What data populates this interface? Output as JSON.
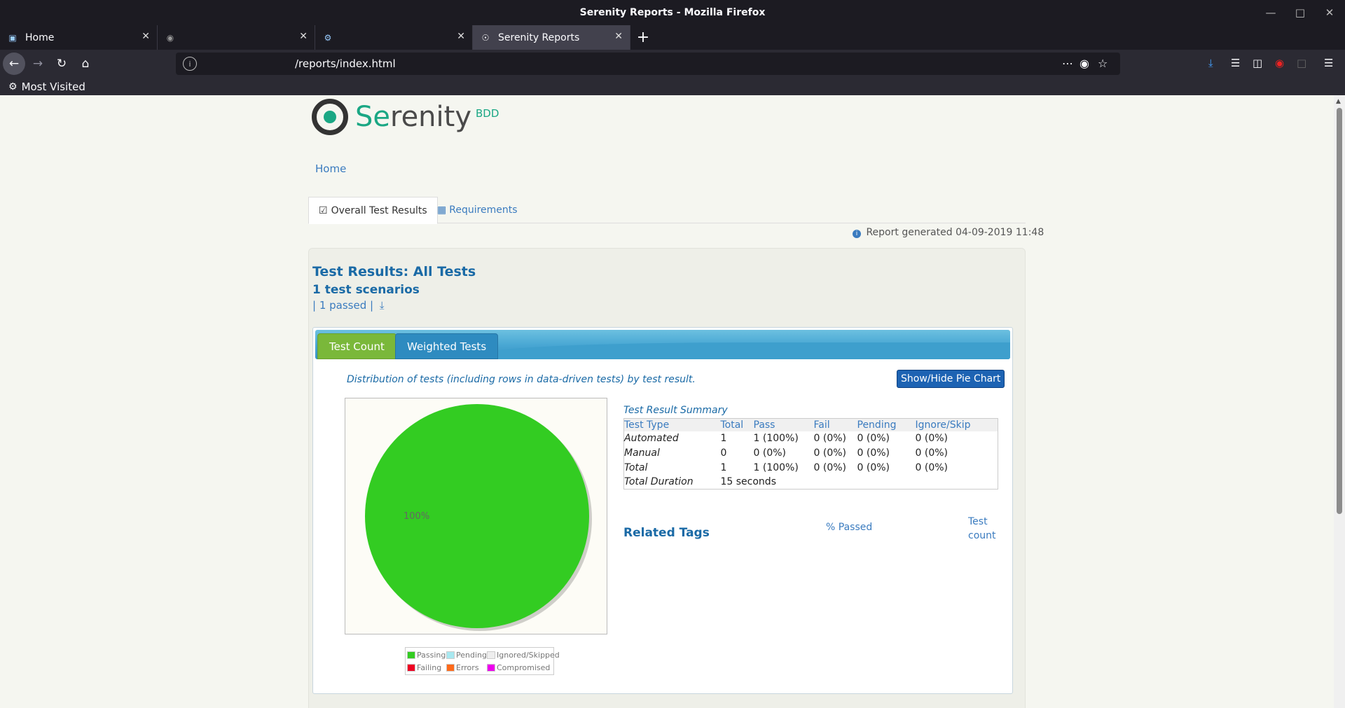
{
  "window": {
    "title": "Serenity Reports - Mozilla Firefox"
  },
  "tabs": [
    {
      "label": "Home",
      "icon": "page-icon"
    },
    {
      "label": "",
      "icon": "github-icon"
    },
    {
      "label": "",
      "icon": "puzzle-icon"
    },
    {
      "label": "Serenity Reports",
      "icon": "serenity-icon",
      "active": true
    }
  ],
  "urlbar": {
    "url": "/reports/index.html"
  },
  "bookmarks": {
    "most_visited": "Most Visited"
  },
  "logo": {
    "word_prefix": "Se",
    "word_rest": "renity",
    "bdd": "BDD"
  },
  "nav": {
    "home": "Home"
  },
  "page_tabs": {
    "overall": "Overall Test Results",
    "requirements": "Requirements"
  },
  "report_generated": "Report generated 04-09-2019 11:48",
  "results": {
    "title": "Test Results: All Tests",
    "scenarios": "1 test scenarios",
    "passed": "| 1 passed |"
  },
  "chart_tabs": {
    "test_count": "Test Count",
    "weighted": "Weighted Tests"
  },
  "distribution_text": "Distribution of tests (including rows in data-driven tests) by test result.",
  "pie_button": "Show/Hide Pie Chart",
  "chart_data": {
    "type": "pie",
    "slices": [
      {
        "label": "Passing",
        "value": 100,
        "color": "#33cc22"
      }
    ],
    "data_labels": [
      "100%"
    ],
    "legend": [
      {
        "label": "Passing",
        "color": "#33cc22"
      },
      {
        "label": "Pending",
        "color": "#a8e8f0"
      },
      {
        "label": "Ignored/Skipped",
        "color": "#eeeeee"
      },
      {
        "label": "Failing",
        "color": "#ee0022"
      },
      {
        "label": "Errors",
        "color": "#ff6a1a"
      },
      {
        "label": "Compromised",
        "color": "#ee00ee"
      }
    ]
  },
  "summary": {
    "title": "Test Result Summary",
    "headers": [
      "Test Type",
      "Total",
      "Pass",
      "Fail",
      "Pending",
      "Ignore/Skip"
    ],
    "rows": [
      [
        "Automated",
        "1",
        "1 (100%)",
        "0 (0%)",
        "0 (0%)",
        "0 (0%)"
      ],
      [
        "Manual",
        "0",
        "0 (0%)",
        "0 (0%)",
        "0 (0%)",
        "0 (0%)"
      ],
      [
        "Total",
        "1",
        "1 (100%)",
        "0 (0%)",
        "0 (0%)",
        "0 (0%)"
      ]
    ],
    "duration_label": "Total Duration",
    "duration_value": "15 seconds"
  },
  "related": {
    "title": "Related Tags",
    "pct_passed": "% Passed",
    "test_count_1": "Test",
    "test_count_2": "count"
  }
}
